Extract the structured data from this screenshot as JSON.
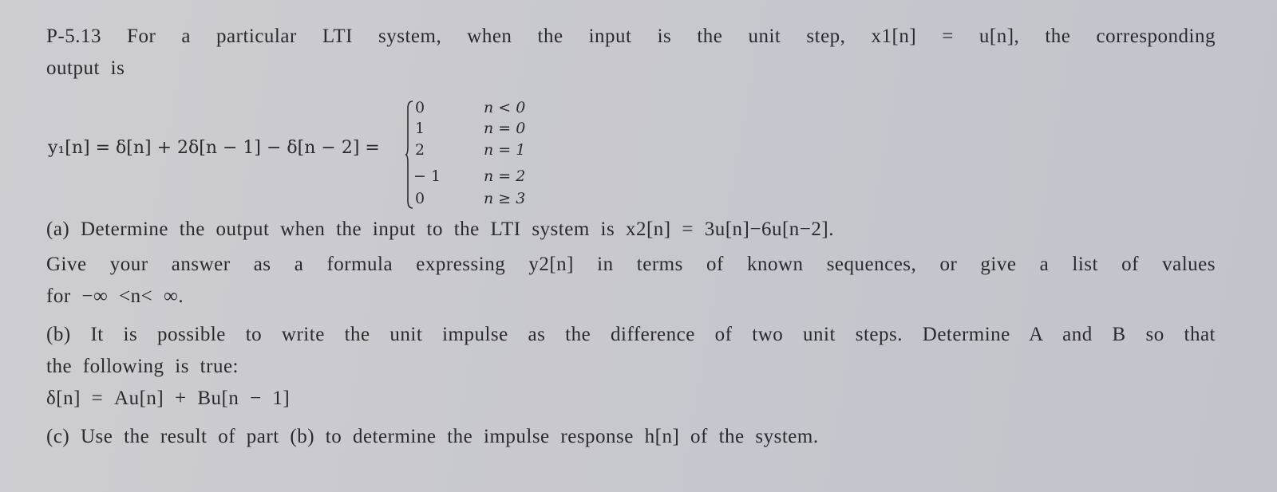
{
  "problem": {
    "intro_line1": "P-5.13 For a particular LTI system, when the input is the unit step, x1[n] = u[n], the corresponding",
    "intro_line2": "output is",
    "equation_lhs": "y₁[n] = δ[n] + 2δ[n − 1] − δ[n − 2] =",
    "cases": [
      {
        "value": "0",
        "condition": "n < 0"
      },
      {
        "value": "1",
        "condition": "n = 0"
      },
      {
        "value": "2",
        "condition": "n = 1"
      },
      {
        "value": "− 1",
        "condition": "n = 2"
      },
      {
        "value": "0",
        "condition": "n ≥ 3"
      }
    ],
    "part_a": {
      "line1": "(a) Determine the output when the input to the LTI system is x2[n] = 3u[n]−6u[n−2].",
      "line2": "Give your answer as a formula expressing y2[n] in terms of known sequences, or give a list of values",
      "line3": "for −∞ <n< ∞."
    },
    "part_b": {
      "line1": "(b) It is possible to write the unit impulse as the difference of two unit steps. Determine A and B so that",
      "line2": "the following is true:",
      "equation": "δ[n] = Au[n] + Bu[n − 1]"
    },
    "part_c": {
      "line1": "(c) Use the result of part (b) to determine the impulse response h[n] of the system."
    }
  }
}
